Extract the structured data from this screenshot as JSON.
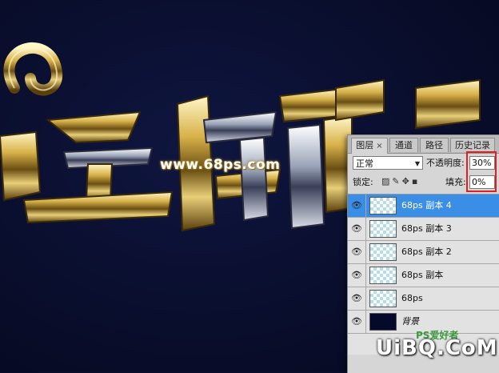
{
  "artwork": {
    "watermark_url": "www.68ps.com"
  },
  "panel": {
    "tabs": [
      {
        "label": "图层",
        "close": "×"
      },
      {
        "label": "通道"
      },
      {
        "label": "路径"
      },
      {
        "label": "历史记录"
      }
    ],
    "blend_mode": "正常",
    "opacity_label": "不透明度:",
    "opacity_value": "30%",
    "lock_label": "锁定:",
    "fill_label": "填充:",
    "fill_value": "0%",
    "layers": [
      {
        "name": "68ps 副本 4",
        "selected": true
      },
      {
        "name": "68ps 副本 3"
      },
      {
        "name": "68ps 副本 2"
      },
      {
        "name": "68ps  副本"
      },
      {
        "name": "68ps"
      },
      {
        "name": "背景"
      }
    ]
  },
  "watermarks": {
    "site_small": "PS爱好者",
    "site_big": "UiBQ.CoM"
  },
  "icons": {
    "eye": "eye-icon",
    "lock_transparent": "lock-transparent-icon",
    "lock_brush": "brush-icon",
    "lock_move": "move-icon",
    "lock_all": "lock-icon"
  }
}
